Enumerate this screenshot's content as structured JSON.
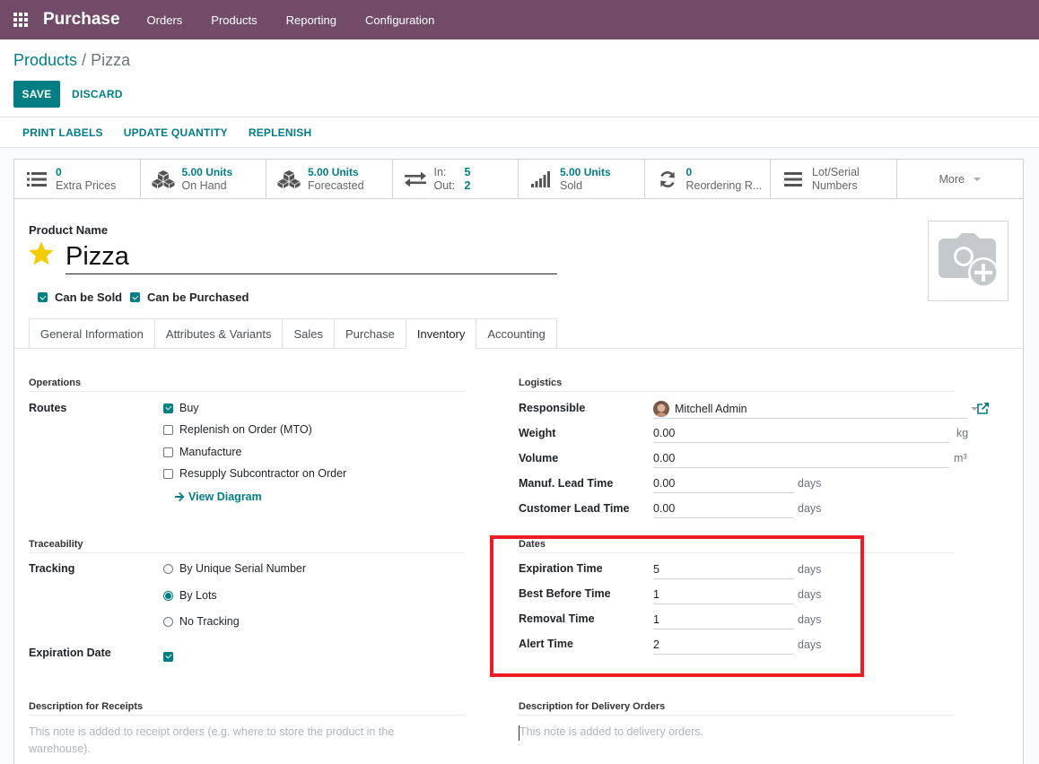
{
  "nav": {
    "app_name": "Purchase",
    "menu": [
      "Orders",
      "Products",
      "Reporting",
      "Configuration"
    ]
  },
  "breadcrumb": {
    "parent": "Products",
    "separator": " / ",
    "current": "Pizza"
  },
  "actions": {
    "save": "SAVE",
    "discard": "DISCARD"
  },
  "statusbar": {
    "buttons": [
      "PRINT LABELS",
      "UPDATE QUANTITY",
      "REPLENISH"
    ]
  },
  "smart_buttons": {
    "extra_prices": {
      "value": "0",
      "label": "Extra Prices"
    },
    "on_hand": {
      "value": "5.00 Units",
      "label": "On Hand"
    },
    "forecasted": {
      "value": "5.00 Units",
      "label": "Forecasted"
    },
    "in_out": {
      "in_label": "In:",
      "in_value": "5",
      "out_label": "Out:",
      "out_value": "2"
    },
    "sold": {
      "value": "5.00 Units",
      "label": "Sold"
    },
    "reordering": {
      "value": "0",
      "label": "Reordering R..."
    },
    "lots": {
      "line1": "Lot/Serial",
      "line2": "Numbers"
    },
    "more": "More"
  },
  "product": {
    "name_label": "Product Name",
    "name": "Pizza",
    "can_be_sold": "Can be Sold",
    "can_be_purchased": "Can be Purchased"
  },
  "tabs": [
    "General Information",
    "Attributes & Variants",
    "Sales",
    "Purchase",
    "Inventory",
    "Accounting"
  ],
  "operations": {
    "title": "Operations",
    "routes_label": "Routes",
    "routes": [
      {
        "label": "Buy",
        "checked": true
      },
      {
        "label": "Replenish on Order (MTO)",
        "checked": false
      },
      {
        "label": "Manufacture",
        "checked": false
      },
      {
        "label": "Resupply Subcontractor on Order",
        "checked": false
      }
    ],
    "view_diagram": "View Diagram"
  },
  "logistics": {
    "title": "Logistics",
    "responsible_label": "Responsible",
    "responsible": "Mitchell Admin",
    "weight_label": "Weight",
    "weight": "0.00",
    "weight_unit": "kg",
    "volume_label": "Volume",
    "volume": "0.00",
    "volume_unit": "m³",
    "manuf_label": "Manuf. Lead Time",
    "manuf": "0.00",
    "manuf_unit": "days",
    "customer_label": "Customer Lead Time",
    "customer": "0.00",
    "customer_unit": "days"
  },
  "traceability": {
    "title": "Traceability",
    "tracking_label": "Tracking",
    "options": [
      {
        "label": "By Unique Serial Number",
        "selected": false
      },
      {
        "label": "By Lots",
        "selected": true
      },
      {
        "label": "No Tracking",
        "selected": false
      }
    ],
    "expiration_label": "Expiration Date"
  },
  "dates": {
    "title": "Dates",
    "expiration_label": "Expiration Time",
    "expiration": "5",
    "best_before_label": "Best Before Time",
    "best_before": "1",
    "removal_label": "Removal Time",
    "removal": "1",
    "alert_label": "Alert Time",
    "alert": "2",
    "unit": "days"
  },
  "descriptions": {
    "receipts_title": "Description for Receipts",
    "receipts_placeholder": "This note is added to receipt orders (e.g. where to store the product in the warehouse).",
    "delivery_title": "Description for Delivery Orders",
    "delivery_placeholder": "This note is added to delivery orders."
  },
  "colors": {
    "navbar": "#714b67",
    "accent": "#017e84",
    "highlight": "#ee1c25",
    "star": "#f3cc00"
  }
}
